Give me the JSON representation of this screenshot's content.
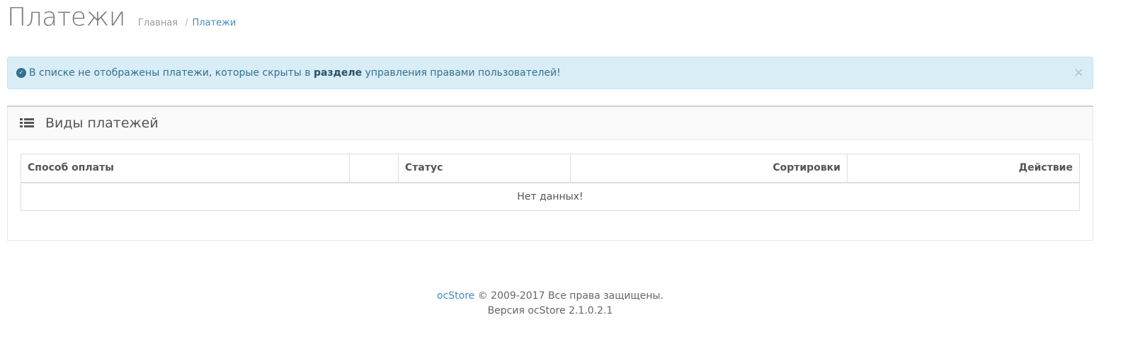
{
  "header": {
    "title": "Платежи",
    "breadcrumb": {
      "home": "Главная",
      "separator": "/",
      "current": "Платежи"
    }
  },
  "alert": {
    "text_before": "В списке не отображены платежи, которые скрыты в",
    "link_word": "разделе",
    "text_after": "управления правами пользователей!",
    "close": "×"
  },
  "panel": {
    "title": "Виды платежей",
    "table": {
      "columns": {
        "method": "Способ оплаты",
        "blank": "",
        "status": "Статус",
        "sort": "Сортировки",
        "action": "Действие"
      },
      "empty_message": "Нет данных!"
    }
  },
  "footer": {
    "brand": "ocStore",
    "copyright": "© 2009-2017 Все права защищены.",
    "version": "Версия ocStore 2.1.0.2.1"
  },
  "colors": {
    "link": "#3a8ec4",
    "alert_bg": "#d9edf7",
    "alert_text": "#31708f"
  }
}
